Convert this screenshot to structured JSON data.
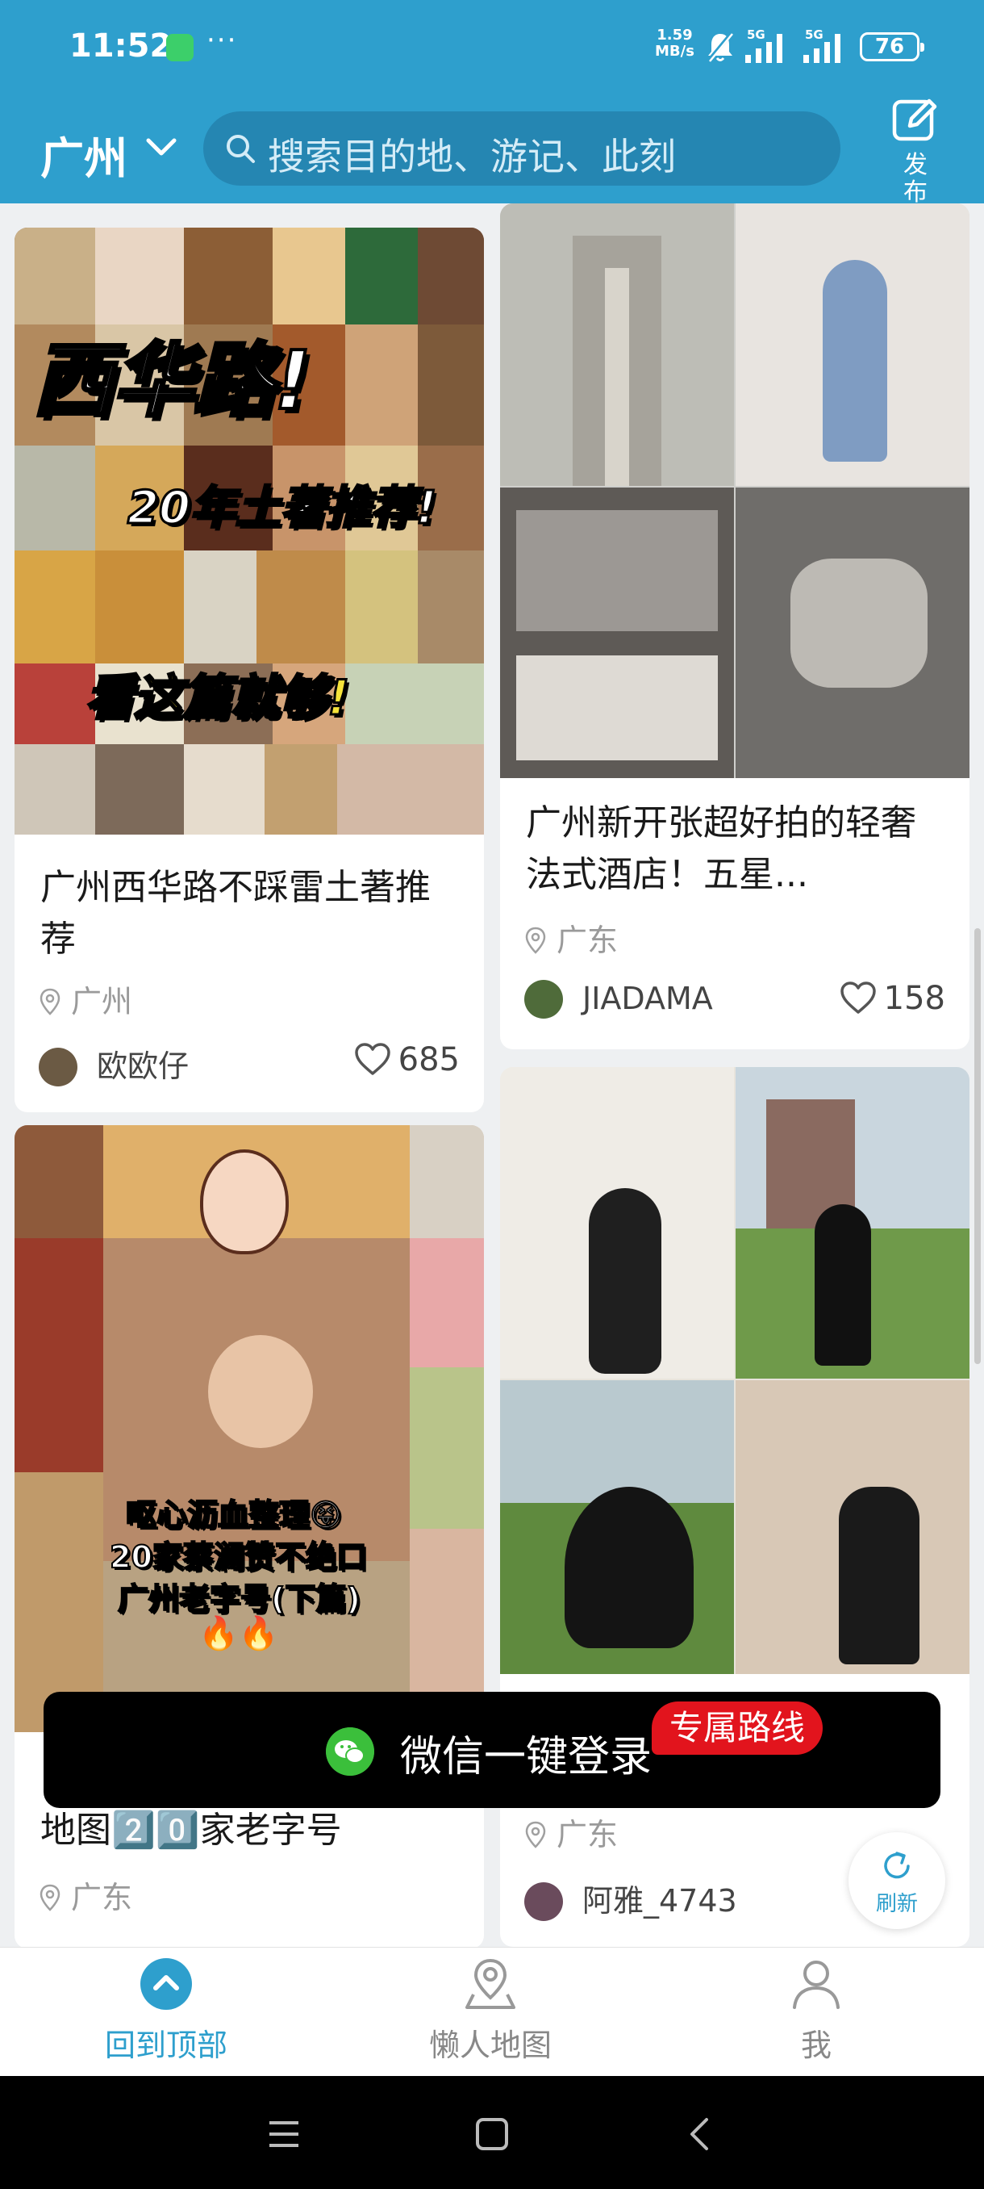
{
  "status_bar": {
    "time": "11:52",
    "more": "···",
    "speed_value": "1.59",
    "speed_unit": "MB/s",
    "signal_1": "5G",
    "signal_2": "5G",
    "battery": "76"
  },
  "header": {
    "city": "广州",
    "search_placeholder": "搜索目的地、游记、此刻",
    "publish_label": "发布"
  },
  "feed": {
    "left": [
      {
        "overlay_lines": [
          "西华路!",
          "20年土著推荐!",
          "看这篇就够!"
        ],
        "title": "广州西华路不踩雷土著推荐",
        "location": "广州",
        "author": "欧欧仔",
        "likes": "685"
      },
      {
        "overlay_lines": [
          "呕心沥血整理😝",
          "20家蔡澜赞不绝口",
          "广州老字号(下篇)",
          "🔥🔥"
        ],
        "title": "地图2️⃣0️⃣家老字号",
        "location": "广东"
      }
    ],
    "right": [
      {
        "title": "广州新开张超好拍的轻奢法式酒店！五星...",
        "location": "广东",
        "author": "JIADAMA",
        "likes": "158"
      },
      {
        "location": "广东",
        "author": "阿雅_4743"
      }
    ]
  },
  "toast": {
    "text": "微信一键登录",
    "badge": "专属路线"
  },
  "refresh_label": "刷新",
  "bottom_nav": [
    {
      "label": "回到顶部",
      "icon": "chevron-up-circle-icon",
      "active": true
    },
    {
      "label": "懒人地图",
      "icon": "map-pin-icon",
      "active": false
    },
    {
      "label": "我",
      "icon": "person-icon",
      "active": false
    }
  ],
  "colors": {
    "brand": "#2e9fcd",
    "toast_bg": "#000000",
    "badge": "#e2141d",
    "wechat": "#3bbf3b"
  }
}
